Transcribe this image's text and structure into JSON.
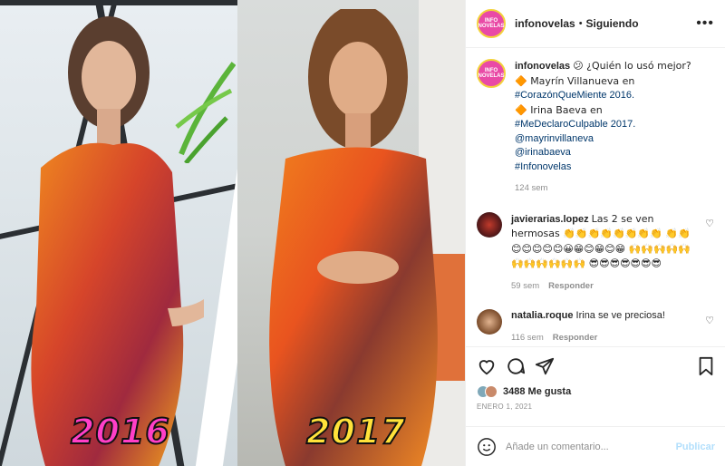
{
  "post": {
    "username": "infonovelas",
    "separator": "•",
    "follow_state": "Siguiendo",
    "avatar_text": "INFO\nNOVELAS",
    "more_icon": "more-horizontal-icon",
    "caption": {
      "username": "infonovelas",
      "lines": [
        "😕 ¿Quién lo usó mejor?",
        "🔶 Mayrín Villanueva en",
        "#CorazónQueMiente 2016.",
        "🔶 Irina Baeva en",
        "#MeDeclaroCulpable 2017.",
        "@mayrinvillaneva",
        "@irinabaeva",
        "#Infonovelas"
      ],
      "time": "124 sem"
    },
    "comments": [
      {
        "username": "javierarias.lopez",
        "text": "Las 2 se ven hermosas 👏👏👏👏👏👏👏👏 👏👏😊😊😊😊😊😀😁😊😁😊😁 🙌🙌🙌🙌🙌🙌🙌🙌🙌🙌🙌 😎😎😎😎😎😎😎",
        "time": "59 sem",
        "reply": "Responder"
      },
      {
        "username": "natalia.roque",
        "text": "Irina se ve preciosa!",
        "time": "116 sem",
        "reply": "Responder"
      }
    ],
    "likes_text": "3488 Me gusta",
    "date": "ENERO 1, 2021",
    "add_comment_placeholder": "Añade un comentario...",
    "publish_label": "Publicar"
  },
  "media": {
    "label_left": "2016",
    "label_right": "2017"
  },
  "colors": {
    "avatar_bg": "#e94aa6",
    "link": "#00376b",
    "publish_disabled": "#b2dffc",
    "label_2016": "#ff3fc8",
    "label_2017": "#ffe23a"
  }
}
